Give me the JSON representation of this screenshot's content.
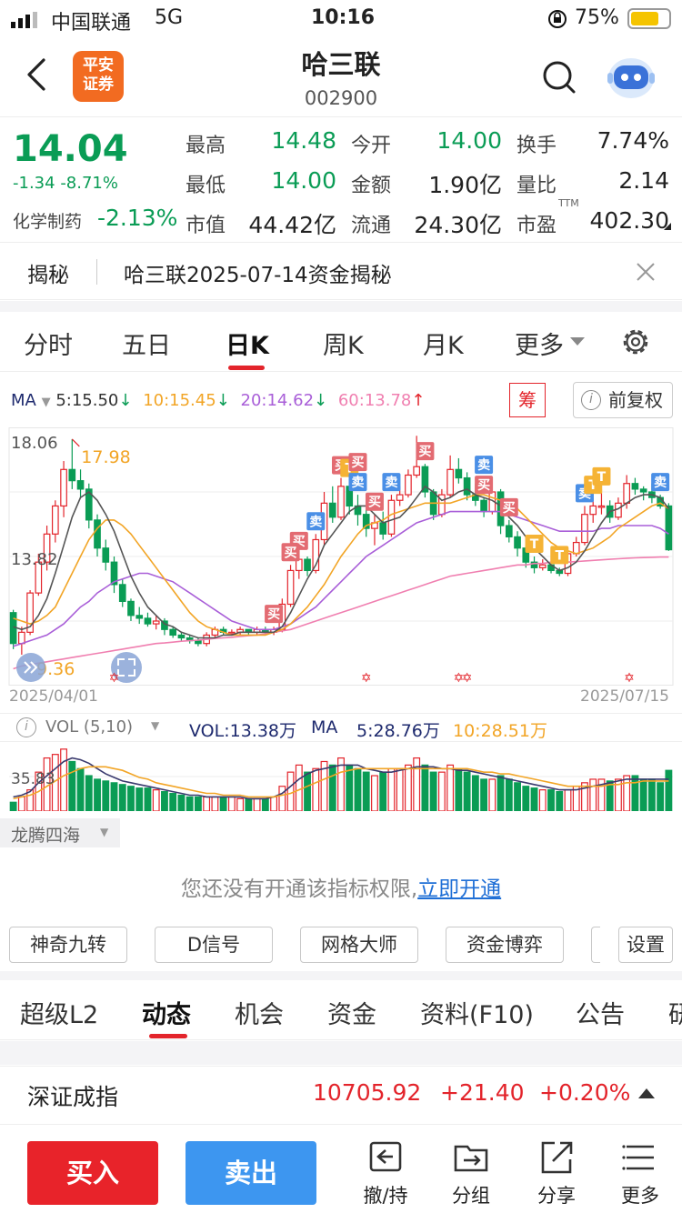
{
  "status_bar": {
    "carrier": "中国联通",
    "network": "5G",
    "time": "10:16",
    "battery": "75%"
  },
  "header": {
    "broker_logo": "平安\n证券",
    "broker_line1": "平安",
    "broker_line2": "证券",
    "stock_name": "哈三联",
    "stock_code": "002900",
    "icons": [
      "back-icon",
      "search-icon",
      "robot-icon"
    ]
  },
  "quote": {
    "price": "14.04",
    "change": "-1.34",
    "change_pct": "-8.71%",
    "sector": "化学制药",
    "sector_pct": "-2.13%",
    "fields": [
      {
        "label": "最高",
        "value": "14.48"
      },
      {
        "label": "今开",
        "value": "14.00"
      },
      {
        "label": "换手",
        "value": "7.74%"
      },
      {
        "label": "最低",
        "value": "14.00"
      },
      {
        "label": "金额",
        "value": "1.90亿"
      },
      {
        "label": "量比",
        "value": "2.14"
      },
      {
        "label": "市值",
        "value": "44.42亿"
      },
      {
        "label": "流通",
        "value": "24.30亿"
      },
      {
        "label": "市盈",
        "value": "402.30"
      }
    ],
    "pe_sup": "TTM"
  },
  "reveal": {
    "tag": "揭秘",
    "text": "哈三联2025-07-14资金揭秘"
  },
  "period_tabs": [
    "分时",
    "五日",
    "日K",
    "周K",
    "月K",
    "更多"
  ],
  "active_period": "日K",
  "chart_legend": {
    "ma_label": "MA",
    "ma5": "5:15.50",
    "ma10": "10:15.45",
    "ma20": "20:14.62",
    "ma60": "60:13.78",
    "chip_button": "筹",
    "adjust_button": "前复权"
  },
  "colors": {
    "up": "#e3242b",
    "down": "#0a9c55",
    "ma5": "#555555",
    "ma10": "#f2a526",
    "ma20": "#a95fd8",
    "ma60": "#f07fb0",
    "accent_blue": "#4a8fe6"
  },
  "chart_data": {
    "type": "candlestick",
    "title": "",
    "y_labels": [
      "18.06",
      "13.82"
    ],
    "high_annotation": "17.98",
    "low_annotation": "9.36",
    "x_labels": [
      "2025/04/01",
      "2025/07/15"
    ],
    "ohlc": [
      [
        11.8,
        11.9,
        10.5,
        10.7
      ],
      [
        10.7,
        11.3,
        10.3,
        11.1
      ],
      [
        11.1,
        12.6,
        11.0,
        12.5
      ],
      [
        12.5,
        13.9,
        12.4,
        13.6
      ],
      [
        13.6,
        14.9,
        13.3,
        14.6
      ],
      [
        14.6,
        15.8,
        14.3,
        15.6
      ],
      [
        15.6,
        17.2,
        15.2,
        16.9
      ],
      [
        16.9,
        17.98,
        16.2,
        16.5
      ],
      [
        16.5,
        16.9,
        15.9,
        16.2
      ],
      [
        16.2,
        16.4,
        14.8,
        15.1
      ],
      [
        15.1,
        15.3,
        13.8,
        14.1
      ],
      [
        14.1,
        14.4,
        13.3,
        13.6
      ],
      [
        13.6,
        13.8,
        12.5,
        12.8
      ],
      [
        12.8,
        13.0,
        12.0,
        12.2
      ],
      [
        12.2,
        12.3,
        11.5,
        11.7
      ],
      [
        11.7,
        12.0,
        11.4,
        11.6
      ],
      [
        11.6,
        11.8,
        11.3,
        11.4
      ],
      [
        11.4,
        11.7,
        11.2,
        11.5
      ],
      [
        11.5,
        11.6,
        11.0,
        11.2
      ],
      [
        11.2,
        11.3,
        10.9,
        11.0
      ],
      [
        11.0,
        11.1,
        10.8,
        10.9
      ],
      [
        10.9,
        11.0,
        10.7,
        10.8
      ],
      [
        10.8,
        10.9,
        10.6,
        10.7
      ],
      [
        10.7,
        11.1,
        10.6,
        11.0
      ],
      [
        11.0,
        11.3,
        10.9,
        11.2
      ],
      [
        11.2,
        11.3,
        11.0,
        11.1
      ],
      [
        11.1,
        11.2,
        11.0,
        11.1
      ],
      [
        11.1,
        11.3,
        11.0,
        11.2
      ],
      [
        11.2,
        11.2,
        11.0,
        11.1
      ],
      [
        11.1,
        11.3,
        11.0,
        11.2
      ],
      [
        11.2,
        11.3,
        11.0,
        11.1
      ],
      [
        11.1,
        11.3,
        11.0,
        11.2
      ],
      [
        11.2,
        12.3,
        11.1,
        12.1
      ],
      [
        12.1,
        13.5,
        12.0,
        13.3
      ],
      [
        13.3,
        13.9,
        13.0,
        13.7
      ],
      [
        13.7,
        13.8,
        13.1,
        13.3
      ],
      [
        13.3,
        14.6,
        13.2,
        14.4
      ],
      [
        14.4,
        16.1,
        14.2,
        15.7
      ],
      [
        15.7,
        16.3,
        15.0,
        15.2
      ],
      [
        15.2,
        16.6,
        15.1,
        16.3
      ],
      [
        16.3,
        16.5,
        15.3,
        15.6
      ],
      [
        15.6,
        16.0,
        14.9,
        15.3
      ],
      [
        15.3,
        15.6,
        14.5,
        14.8
      ],
      [
        14.8,
        15.3,
        14.2,
        15.0
      ],
      [
        15.0,
        15.4,
        14.4,
        14.6
      ],
      [
        14.6,
        16.0,
        14.5,
        15.8
      ],
      [
        15.8,
        16.3,
        15.6,
        16.0
      ],
      [
        16.0,
        16.9,
        15.9,
        16.7
      ],
      [
        16.7,
        18.1,
        16.6,
        17.0
      ],
      [
        17.0,
        17.1,
        15.9,
        16.1
      ],
      [
        16.1,
        16.2,
        15.1,
        15.3
      ],
      [
        15.3,
        16.2,
        15.2,
        16.0
      ],
      [
        16.0,
        17.4,
        15.9,
        16.9
      ],
      [
        16.9,
        17.3,
        16.4,
        16.6
      ],
      [
        16.6,
        16.8,
        15.8,
        16.0
      ],
      [
        16.0,
        16.4,
        15.6,
        15.8
      ],
      [
        15.8,
        15.9,
        15.2,
        15.4
      ],
      [
        15.4,
        16.3,
        15.3,
        16.1
      ],
      [
        16.1,
        16.2,
        14.6,
        14.9
      ],
      [
        14.9,
        15.1,
        14.3,
        14.5
      ],
      [
        14.5,
        14.7,
        13.8,
        14.1
      ],
      [
        14.1,
        14.2,
        13.4,
        13.6
      ],
      [
        13.6,
        13.8,
        13.2,
        13.4
      ],
      [
        13.4,
        13.7,
        13.3,
        13.5
      ],
      [
        13.5,
        13.6,
        13.2,
        13.3
      ],
      [
        13.3,
        13.4,
        13.1,
        13.2
      ],
      [
        13.2,
        14.1,
        13.1,
        13.9
      ],
      [
        13.9,
        14.5,
        13.8,
        14.3
      ],
      [
        14.3,
        15.6,
        14.2,
        15.3
      ],
      [
        15.3,
        15.9,
        15.0,
        15.6
      ],
      [
        15.6,
        16.2,
        15.3,
        15.6
      ],
      [
        15.6,
        15.8,
        15.0,
        15.2
      ],
      [
        15.2,
        15.9,
        15.1,
        15.7
      ],
      [
        15.7,
        16.7,
        15.5,
        16.4
      ],
      [
        16.4,
        16.6,
        16.0,
        16.2
      ],
      [
        16.2,
        16.3,
        15.8,
        16.1
      ],
      [
        16.1,
        16.4,
        15.7,
        15.9
      ],
      [
        15.9,
        16.0,
        15.5,
        15.6
      ],
      [
        15.6,
        15.7,
        14.0,
        14.04
      ]
    ],
    "ma5": [
      11.3,
      11.2,
      11.3,
      11.7,
      12.3,
      13.2,
      14.2,
      15.2,
      15.9,
      16.1,
      15.8,
      15.3,
      14.7,
      13.9,
      13.1,
      12.5,
      12.0,
      11.7,
      11.4,
      11.3,
      11.1,
      11.0,
      10.9,
      10.9,
      10.9,
      11.0,
      11.0,
      11.1,
      11.1,
      11.1,
      11.1,
      11.1,
      11.3,
      11.8,
      12.4,
      13.0,
      13.5,
      14.2,
      14.6,
      15.0,
      15.4,
      15.6,
      15.6,
      15.3,
      15.0,
      15.1,
      15.2,
      15.5,
      15.9,
      16.3,
      16.1,
      15.8,
      15.9,
      16.1,
      16.2,
      16.0,
      15.9,
      15.8,
      15.6,
      15.2,
      14.9,
      14.5,
      14.1,
      13.8,
      13.5,
      13.3,
      13.4,
      13.6,
      14.0,
      14.5,
      15.0,
      15.4,
      15.5,
      15.7,
      15.9,
      16.0,
      16.0,
      15.9,
      15.5
    ],
    "ma10": [
      11.6,
      11.5,
      11.4,
      11.5,
      11.7,
      12.0,
      12.6,
      13.2,
      13.8,
      14.4,
      14.8,
      15.1,
      15.1,
      14.9,
      14.6,
      14.2,
      13.8,
      13.4,
      13.0,
      12.6,
      12.2,
      11.8,
      11.5,
      11.3,
      11.2,
      11.1,
      11.0,
      11.0,
      11.0,
      11.0,
      11.0,
      11.1,
      11.2,
      11.4,
      11.7,
      12.0,
      12.4,
      12.8,
      13.3,
      13.8,
      14.2,
      14.6,
      14.9,
      15.0,
      15.1,
      15.3,
      15.4,
      15.5,
      15.6,
      15.7,
      15.7,
      15.7,
      15.7,
      15.8,
      15.9,
      16.0,
      16.0,
      15.9,
      15.8,
      15.7,
      15.5,
      15.2,
      14.9,
      14.6,
      14.3,
      14.1,
      14.0,
      13.9,
      14.0,
      14.1,
      14.3,
      14.5,
      14.8,
      15.0,
      15.2,
      15.4,
      15.6,
      15.7,
      15.5
    ],
    "ma20": [
      10.6,
      10.7,
      10.8,
      10.9,
      11.0,
      11.2,
      11.4,
      11.7,
      12.0,
      12.2,
      12.5,
      12.7,
      12.9,
      13.0,
      13.1,
      13.2,
      13.2,
      13.1,
      13.0,
      12.9,
      12.7,
      12.5,
      12.3,
      12.1,
      11.9,
      11.7,
      11.5,
      11.4,
      11.3,
      11.2,
      11.2,
      11.2,
      11.3,
      11.4,
      11.6,
      11.8,
      12.0,
      12.3,
      12.6,
      12.9,
      13.2,
      13.5,
      13.8,
      14.0,
      14.2,
      14.4,
      14.6,
      14.8,
      15.0,
      15.1,
      15.2,
      15.3,
      15.4,
      15.4,
      15.4,
      15.4,
      15.4,
      15.4,
      15.4,
      15.3,
      15.2,
      15.1,
      15.0,
      14.9,
      14.8,
      14.7,
      14.7,
      14.7,
      14.7,
      14.7,
      14.8,
      14.8,
      14.9,
      14.9,
      14.9,
      14.9,
      14.9,
      14.8,
      14.6
    ],
    "ma60": [
      9.8,
      9.9,
      9.95,
      10.0,
      10.05,
      10.1,
      10.15,
      10.2,
      10.25,
      10.3,
      10.35,
      10.4,
      10.45,
      10.5,
      10.55,
      10.6,
      10.65,
      10.7,
      10.72,
      10.75,
      10.78,
      10.8,
      10.82,
      10.85,
      10.88,
      10.9,
      10.92,
      10.95,
      10.98,
      11.0,
      11.05,
      11.1,
      11.15,
      11.2,
      11.3,
      11.4,
      11.5,
      11.6,
      11.7,
      11.8,
      11.9,
      12.0,
      12.1,
      12.2,
      12.3,
      12.4,
      12.5,
      12.6,
      12.7,
      12.8,
      12.9,
      13.0,
      13.1,
      13.15,
      13.2,
      13.25,
      13.3,
      13.35,
      13.4,
      13.45,
      13.5,
      13.5,
      13.55,
      13.55,
      13.6,
      13.6,
      13.6,
      13.62,
      13.64,
      13.66,
      13.68,
      13.7,
      13.72,
      13.74,
      13.75,
      13.76,
      13.77,
      13.78,
      13.78
    ],
    "signals": [
      {
        "idx": 36,
        "text": "卖",
        "color": "#4a8fe6"
      },
      {
        "idx": 34,
        "text": "买",
        "color": "#e36b72"
      },
      {
        "idx": 39,
        "text": "买",
        "color": "#e36b72"
      },
      {
        "idx": 40,
        "text": "T",
        "color": "#f5b335"
      },
      {
        "idx": 41,
        "text": "卖",
        "color": "#4a8fe6"
      },
      {
        "idx": 41,
        "text": "买",
        "color": "#e36b72"
      },
      {
        "idx": 43,
        "text": "买",
        "color": "#e36b72"
      },
      {
        "idx": 45,
        "text": "卖",
        "color": "#4a8fe6"
      },
      {
        "idx": 49,
        "text": "买",
        "color": "#e36b72"
      },
      {
        "idx": 56,
        "text": "买",
        "color": "#e36b72"
      },
      {
        "idx": 56,
        "text": "卖",
        "color": "#4a8fe6"
      },
      {
        "idx": 59,
        "text": "买",
        "color": "#e36b72"
      },
      {
        "idx": 62,
        "text": "T",
        "color": "#f5b335"
      },
      {
        "idx": 65,
        "text": "T",
        "color": "#f5b335"
      },
      {
        "idx": 68,
        "text": "卖",
        "color": "#4a8fe6"
      },
      {
        "idx": 69,
        "text": "T",
        "color": "#f5b335"
      },
      {
        "idx": 70,
        "text": "T",
        "color": "#f5b335"
      },
      {
        "idx": 77,
        "text": "卖",
        "color": "#4a8fe6"
      },
      {
        "idx": 33,
        "text": "买",
        "color": "#e36b72"
      },
      {
        "idx": 31,
        "text": "买",
        "color": "#e36b72"
      }
    ],
    "volume": [
      5,
      8,
      12,
      22,
      30,
      32,
      35,
      28,
      24,
      20,
      18,
      17,
      16,
      15,
      14,
      13,
      13,
      12,
      11,
      10,
      9,
      8,
      8,
      8,
      8,
      8,
      8,
      7,
      7,
      7,
      7,
      8,
      14,
      22,
      26,
      22,
      24,
      28,
      26,
      30,
      26,
      24,
      22,
      20,
      22,
      24,
      24,
      26,
      30,
      26,
      22,
      22,
      26,
      24,
      22,
      20,
      18,
      18,
      20,
      18,
      16,
      14,
      13,
      12,
      12,
      11,
      12,
      14,
      16,
      18,
      18,
      17,
      18,
      20,
      20,
      18,
      18,
      16,
      23
    ],
    "vol_ma5": [
      8,
      9,
      11,
      16,
      20,
      24,
      28,
      30,
      29,
      27,
      24,
      21,
      19,
      17,
      16,
      15,
      14,
      13,
      12,
      11,
      10,
      9,
      9,
      8,
      8,
      8,
      8,
      8,
      7,
      7,
      7,
      8,
      10,
      14,
      18,
      21,
      23,
      24,
      25,
      26,
      26,
      26,
      24,
      23,
      22,
      22,
      23,
      24,
      25,
      25,
      25,
      24,
      24,
      23,
      23,
      22,
      21,
      20,
      19,
      18,
      17,
      16,
      15,
      14,
      13,
      12,
      12,
      12,
      13,
      14,
      15,
      16,
      17,
      18,
      18,
      18,
      18,
      18,
      18
    ],
    "vol_ma10": [
      7,
      8,
      9,
      11,
      14,
      17,
      20,
      22,
      24,
      25,
      25,
      25,
      24,
      23,
      21,
      19,
      18,
      16,
      15,
      14,
      13,
      12,
      11,
      10,
      10,
      9,
      9,
      9,
      8,
      8,
      8,
      8,
      9,
      10,
      12,
      14,
      16,
      18,
      20,
      22,
      23,
      24,
      24,
      24,
      24,
      24,
      24,
      24,
      24,
      24,
      24,
      24,
      24,
      24,
      24,
      23,
      22,
      22,
      21,
      21,
      20,
      19,
      18,
      17,
      16,
      15,
      14,
      14,
      14,
      14,
      14,
      15,
      15,
      16,
      16,
      17,
      17,
      17,
      17
    ],
    "volume_label": "35.83"
  },
  "volume_legend": {
    "title": "VOL (5,10)",
    "vol": "VOL:13.38万",
    "ma": "MA",
    "ma5": "5:28.76万",
    "ma10": "10:28.51万"
  },
  "indicator": {
    "name": "龙腾四海",
    "notice": "您还没有开通该指标权限,",
    "link": "立即开通"
  },
  "tool_buttons": [
    "神奇九转",
    "D信号",
    "网格大师",
    "资金博弈"
  ],
  "settings_button": "设置",
  "bottom_tabs": [
    "超级L2",
    "动态",
    "机会",
    "资金",
    "资料(F10)",
    "公告",
    "研"
  ],
  "active_bottom_tab": "动态",
  "index_row": {
    "name": "深证成指",
    "value": "10705.92",
    "change": "+21.40",
    "pct": "+0.20%"
  },
  "actions": {
    "buy": "买入",
    "sell": "卖出",
    "icons": [
      {
        "label": "撤/持",
        "icon": "withdraw-icon"
      },
      {
        "label": "分组",
        "icon": "group-icon"
      },
      {
        "label": "分享",
        "icon": "share-icon"
      },
      {
        "label": "更多",
        "icon": "menu-icon"
      }
    ]
  }
}
